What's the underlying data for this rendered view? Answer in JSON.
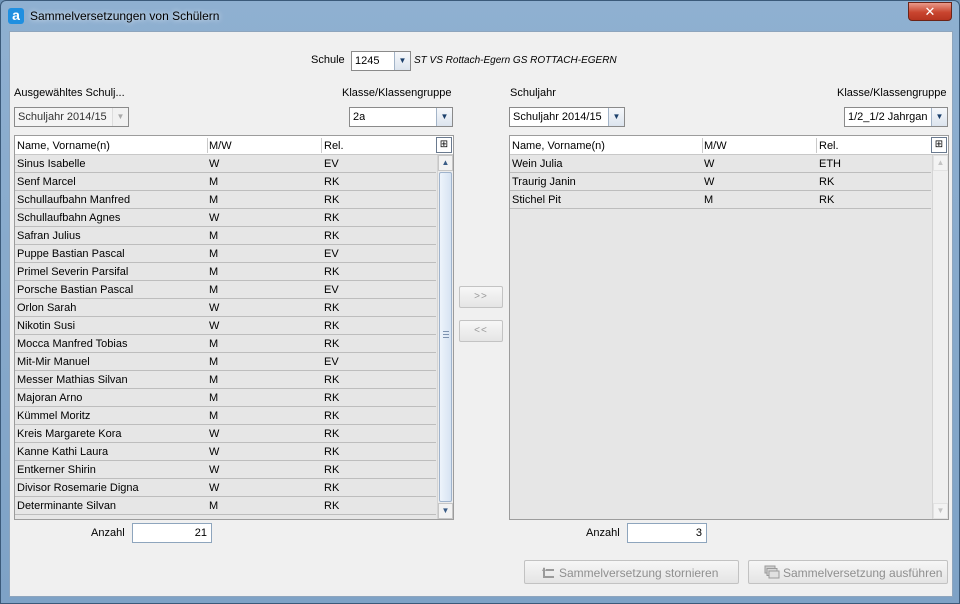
{
  "window": {
    "title": "Sammelversetzungen von Schülern",
    "close_glyph": "✕"
  },
  "school": {
    "label": "Schule",
    "value": "1245",
    "description": "ST VS Rottach-Egern GS ROTTACH-EGERN"
  },
  "left": {
    "schuljahr_label": "Ausgewähltes Schulj...",
    "schuljahr_value": "Schuljahr 2014/15",
    "klasse_label": "Klasse/Klassengruppe",
    "klasse_value": "2a",
    "columns": [
      "Name, Vorname(n)",
      "M/W",
      "Rel."
    ],
    "rows": [
      [
        "Sinus Isabelle",
        "W",
        "EV"
      ],
      [
        "Senf Marcel",
        "M",
        "RK"
      ],
      [
        "Schullaufbahn Manfred",
        "M",
        "RK"
      ],
      [
        "Schullaufbahn Agnes",
        "W",
        "RK"
      ],
      [
        "Safran Julius",
        "M",
        "RK"
      ],
      [
        "Puppe Bastian Pascal",
        "M",
        "EV"
      ],
      [
        "Primel Severin Parsifal",
        "M",
        "RK"
      ],
      [
        "Porsche Bastian Pascal",
        "M",
        "EV"
      ],
      [
        "Orlon Sarah",
        "W",
        "RK"
      ],
      [
        "Nikotin Susi",
        "W",
        "RK"
      ],
      [
        "Mocca Manfred Tobias",
        "M",
        "RK"
      ],
      [
        "Mit-Mir Manuel",
        "M",
        "EV"
      ],
      [
        "Messer Mathias Silvan",
        "M",
        "RK"
      ],
      [
        "Majoran Arno",
        "M",
        "RK"
      ],
      [
        "Kümmel Moritz",
        "M",
        "RK"
      ],
      [
        "Kreis Margarete Kora",
        "W",
        "RK"
      ],
      [
        "Kanne Kathi Laura",
        "W",
        "RK"
      ],
      [
        "Entkerner Shirin",
        "W",
        "RK"
      ],
      [
        "Divisor Rosemarie Digna",
        "W",
        "RK"
      ],
      [
        "Determinante Silvan",
        "M",
        "RK"
      ]
    ],
    "count_label": "Anzahl",
    "count_value": "21"
  },
  "right": {
    "schuljahr_label": "Schuljahr",
    "schuljahr_value": "Schuljahr 2014/15",
    "klasse_label": "Klasse/Klassengruppe",
    "klasse_value": "1/2_1/2 Jahrgan",
    "columns": [
      "Name, Vorname(n)",
      "M/W",
      "Rel."
    ],
    "rows": [
      [
        "Wein Julia",
        "W",
        "ETH"
      ],
      [
        "Traurig Janin",
        "W",
        "RK"
      ],
      [
        "Stichel Pit",
        "M",
        "RK"
      ]
    ],
    "count_label": "Anzahl",
    "count_value": "3"
  },
  "transfer": {
    "move_right_label": ">>",
    "move_left_label": "<<"
  },
  "actions": {
    "cancel_label": "Sammelversetzung stornieren",
    "execute_label": "Sammelversetzung ausführen"
  },
  "icons": {
    "app": "app-logo-icon",
    "dropdown": "chevron-down-icon",
    "column_chooser": "column-chooser-icon",
    "undo": "undo-arrow-icon",
    "execute": "stack-documents-icon"
  },
  "colors": {
    "title_bar": "#8fb0d1",
    "close_button": "#c9452f",
    "row_background": "#e6e6e6"
  }
}
